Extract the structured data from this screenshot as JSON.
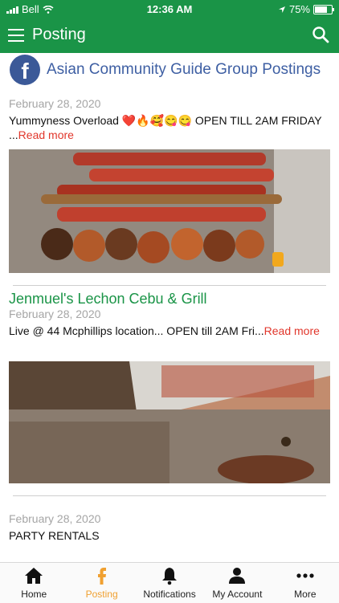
{
  "status_bar": {
    "carrier": "Bell",
    "time": "12:36 AM",
    "battery": "75%"
  },
  "app_bar": {
    "title": "Posting"
  },
  "group": {
    "title": "Asian Community Guide Group Postings"
  },
  "posts": [
    {
      "heading": "",
      "date": "February 28, 2020",
      "text": "Yummyness Overload ❤️🔥🥰😋😋 OPEN TILL 2AM FRIDAY ...",
      "read_more": "Read more"
    },
    {
      "heading": "Jenmuel's Lechon Cebu & Grill",
      "date": "February 28, 2020",
      "text": "Live @ 44 Mcphillips location... OPEN till 2AM Fri...",
      "read_more": "Read more"
    },
    {
      "heading": "",
      "date": "February 28, 2020",
      "text": "PARTY RENTALS"
    }
  ],
  "tabs": [
    {
      "label": "Home",
      "icon": "home-icon"
    },
    {
      "label": "Posting",
      "icon": "facebook-icon"
    },
    {
      "label": "Notifications",
      "icon": "bell-icon"
    },
    {
      "label": "My Account",
      "icon": "person-icon"
    },
    {
      "label": "More",
      "icon": "more-icon"
    }
  ],
  "colors": {
    "primary": "#1a9447",
    "active_tab": "#f0a030",
    "read_more": "#e1362b",
    "facebook": "#3b5998"
  }
}
